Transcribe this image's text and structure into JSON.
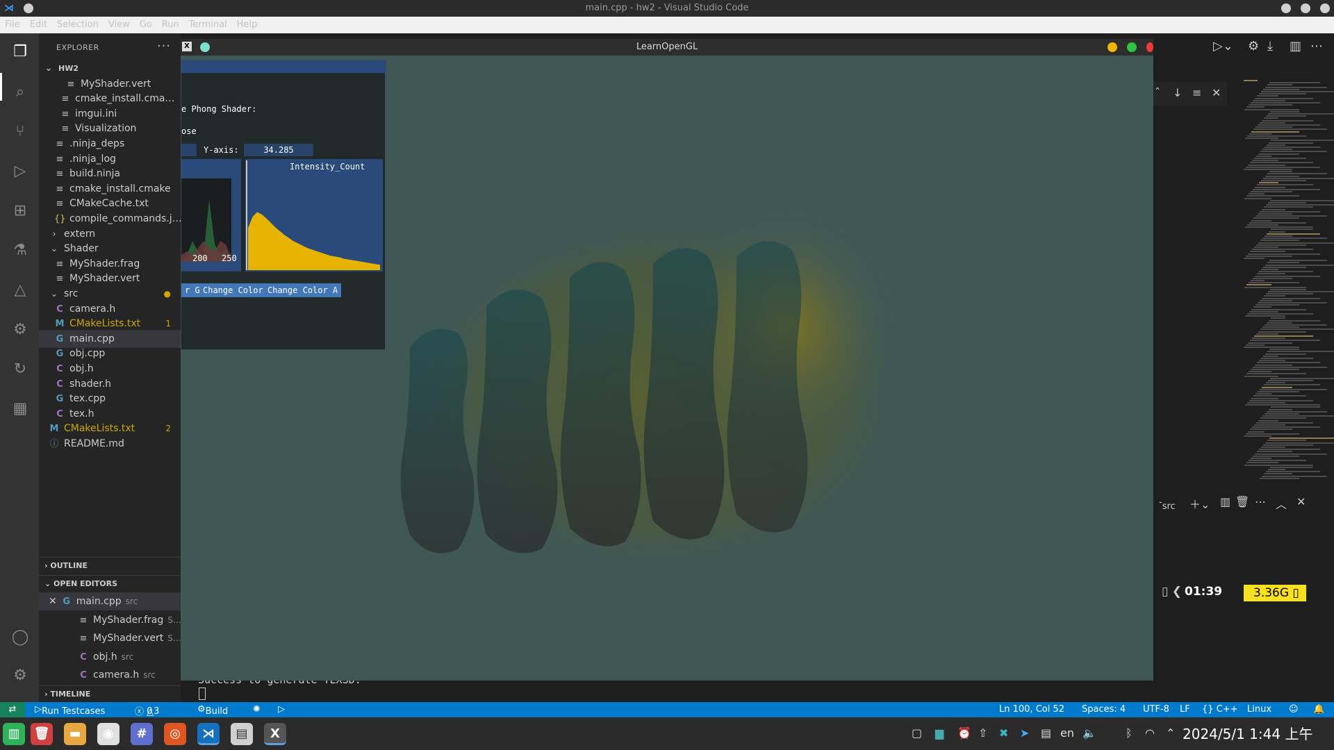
{
  "os_window_title": "main.cpp - hw2 - Visual Studio Code",
  "menu": [
    "File",
    "Edit",
    "Selection",
    "View",
    "Go",
    "Run",
    "Terminal",
    "Help"
  ],
  "explorer": {
    "title": "EXPLORER",
    "more": "···",
    "tree": [
      {
        "label": "HW2",
        "type": "root",
        "depth": 0
      },
      {
        "label": "MyShader.vert",
        "type": "doc",
        "depth": 4
      },
      {
        "label": "cmake_install.cma…",
        "type": "doc",
        "depth": 3
      },
      {
        "label": "imgui.ini",
        "type": "doc",
        "depth": 3
      },
      {
        "label": "Visualization",
        "type": "doc",
        "depth": 3
      },
      {
        "label": ".ninja_deps",
        "type": "doc",
        "depth": 2
      },
      {
        "label": ".ninja_log",
        "type": "doc",
        "depth": 2
      },
      {
        "label": "build.ninja",
        "type": "doc",
        "depth": 2
      },
      {
        "label": "cmake_install.cmake",
        "type": "doc",
        "depth": 2
      },
      {
        "label": "CMakeCache.txt",
        "type": "doc",
        "depth": 2
      },
      {
        "label": "compile_commands.j…",
        "type": "json",
        "depth": 2
      },
      {
        "label": "extern",
        "type": "folder-closed",
        "depth": 1
      },
      {
        "label": "Shader",
        "type": "folder-open",
        "depth": 1
      },
      {
        "label": "MyShader.frag",
        "type": "doc",
        "depth": 2
      },
      {
        "label": "MyShader.vert",
        "type": "doc",
        "depth": 2
      },
      {
        "label": "src",
        "type": "folder-open-warn",
        "depth": 1,
        "badge": "●"
      },
      {
        "label": "camera.h",
        "type": "c",
        "depth": 2
      },
      {
        "label": "CMakeLists.txt",
        "type": "m",
        "depth": 2,
        "badge": "1"
      },
      {
        "label": "main.cpp",
        "type": "cpp",
        "depth": 2,
        "selected": true
      },
      {
        "label": "obj.cpp",
        "type": "cpp",
        "depth": 2
      },
      {
        "label": "obj.h",
        "type": "c",
        "depth": 2
      },
      {
        "label": "shader.h",
        "type": "c",
        "depth": 2
      },
      {
        "label": "tex.cpp",
        "type": "cpp",
        "depth": 2
      },
      {
        "label": "tex.h",
        "type": "c",
        "depth": 2
      },
      {
        "label": "CMakeLists.txt",
        "type": "m",
        "depth": 1,
        "badge": "2"
      },
      {
        "label": "README.md",
        "type": "info",
        "depth": 1
      }
    ],
    "outline": "OUTLINE",
    "open_editors": "OPEN EDITORS",
    "open_files": [
      {
        "label": "main.cpp",
        "hint": "src",
        "type": "cpp",
        "close": "✕"
      },
      {
        "label": "MyShader.frag",
        "hint": "S…",
        "type": "doc"
      },
      {
        "label": "MyShader.vert",
        "hint": "S…",
        "type": "doc"
      },
      {
        "label": "obj.h",
        "hint": "src",
        "type": "c"
      },
      {
        "label": "camera.h",
        "hint": "src",
        "type": "c"
      }
    ],
    "timeline": "TIMELINE"
  },
  "gl_window": {
    "title": "LearnOpenGL",
    "imgui": {
      "text_shader": "e Phong Shader:",
      "text_ose": "ose",
      "y_axis_label": "Y-axis:",
      "y_axis_value": "34.285",
      "plot_title": "Intensity_Count",
      "tick_200": "200",
      "tick_250": "250",
      "btn_g": "r G",
      "btn_b": "Change Color B",
      "btn_a": "Change Color A"
    }
  },
  "terminal": {
    "output": "Success to generate TEXSD.",
    "tab_label": "src",
    "prompt_time": "01:39",
    "prompt_mem": "3.36G"
  },
  "statusbar": {
    "remote": "⇄",
    "run_testcases": "Run Testcases",
    "errors": "0",
    "warnings": "3",
    "build": "Build",
    "position": "Ln 100, Col 52",
    "spaces": "Spaces: 4",
    "encoding": "UTF-8",
    "eol": "LF",
    "language": "{} C++",
    "os": "Linux"
  },
  "taskbar": {
    "clock": "2024/5/1  1:44 上午",
    "lang": "en"
  },
  "colors": {
    "gl_bg": "#3f5856",
    "histogram_fill": "#e6b400",
    "statusbar": "#007acc"
  },
  "chart_data": [
    {
      "type": "area",
      "title": "Intensity_Count",
      "series": [
        {
          "values": [
            0.55,
            0.7,
            0.76,
            0.73,
            0.68,
            0.62,
            0.56,
            0.51,
            0.46,
            0.42,
            0.38,
            0.35,
            0.32,
            0.29,
            0.27,
            0.25,
            0.23,
            0.21,
            0.19,
            0.18,
            0.17,
            0.15,
            0.14,
            0.13,
            0.12,
            0.11,
            0.1,
            0.09,
            0.08,
            0.07
          ]
        }
      ]
    },
    {
      "type": "area",
      "x_ticks": [
        "200",
        "250"
      ],
      "series": [
        {
          "values": [
            0.0,
            0.1,
            0.3,
            0.15,
            0.1,
            0.9,
            0.25,
            0.1,
            0.2,
            0.0
          ]
        },
        {
          "values": [
            0.1,
            0.15,
            0.1,
            0.2,
            0.3,
            0.2,
            0.15,
            0.3,
            0.25,
            0.05
          ]
        }
      ]
    }
  ]
}
